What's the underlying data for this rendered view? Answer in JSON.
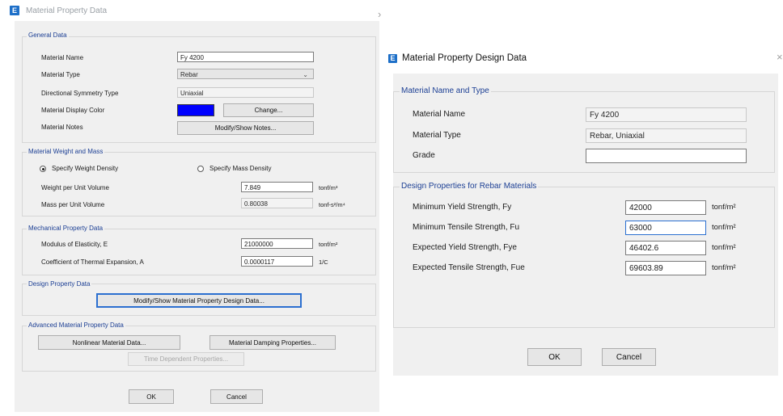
{
  "left_dialog": {
    "title": "Material Property Data",
    "app_icon_glyph": "E",
    "general": {
      "title": "General Data",
      "material_name_label": "Material Name",
      "material_name": "Fy 4200",
      "material_type_label": "Material Type",
      "material_type": "Rebar",
      "symmetry_label": "Directional Symmetry Type",
      "symmetry": "Uniaxial",
      "display_color_label": "Material Display Color",
      "display_color": "#0000ff",
      "change_button": "Change...",
      "notes_label": "Material Notes",
      "notes_button": "Modify/Show Notes..."
    },
    "weight": {
      "title": "Material Weight and Mass",
      "weight_density_option": "Specify Weight Density",
      "mass_density_option": "Specify Mass Density",
      "weight_label": "Weight per Unit Volume",
      "weight_value": "7.849",
      "weight_unit": "tonf/m³",
      "mass_label": "Mass per Unit Volume",
      "mass_value": "0.80038",
      "mass_unit": "tonf-s²/m⁴"
    },
    "mechanical": {
      "title": "Mechanical Property Data",
      "modulus_label": "Modulus of Elasticity,  E",
      "modulus_value": "21000000",
      "modulus_unit": "tonf/m²",
      "thermal_label": "Coefficient of Thermal Expansion,  A",
      "thermal_value": "0.0000117",
      "thermal_unit": "1/C"
    },
    "design": {
      "title": "Design Property Data",
      "button": "Modify/Show Material Property Design Data..."
    },
    "advanced": {
      "title": "Advanced Material Property Data",
      "nonlinear_button": "Nonlinear Material Data...",
      "damping_button": "Material Damping Properties...",
      "time_button": "Time Dependent Properties..."
    },
    "ok": "OK",
    "cancel": "Cancel"
  },
  "right_dialog": {
    "title": "Material Property Design Data",
    "app_icon_glyph": "E",
    "name_type": {
      "title": "Material Name and Type",
      "material_name_label": "Material Name",
      "material_name": "Fy 4200",
      "material_type_label": "Material Type",
      "material_type": "Rebar, Uniaxial",
      "grade_label": "Grade",
      "grade": ""
    },
    "rebar": {
      "title": "Design Properties for Rebar Materials",
      "rows": [
        {
          "label": "Minimum Yield Strength, Fy",
          "value": "42000",
          "unit": "tonf/m²"
        },
        {
          "label": "Minimum Tensile Strength, Fu",
          "value": "63000",
          "unit": "tonf/m²"
        },
        {
          "label": "Expected Yield Strength, Fye",
          "value": "46402.6",
          "unit": "tonf/m²"
        },
        {
          "label": "Expected Tensile Strength, Fue",
          "value": "69603.89",
          "unit": "tonf/m²"
        }
      ]
    },
    "ok": "OK",
    "cancel": "Cancel"
  }
}
